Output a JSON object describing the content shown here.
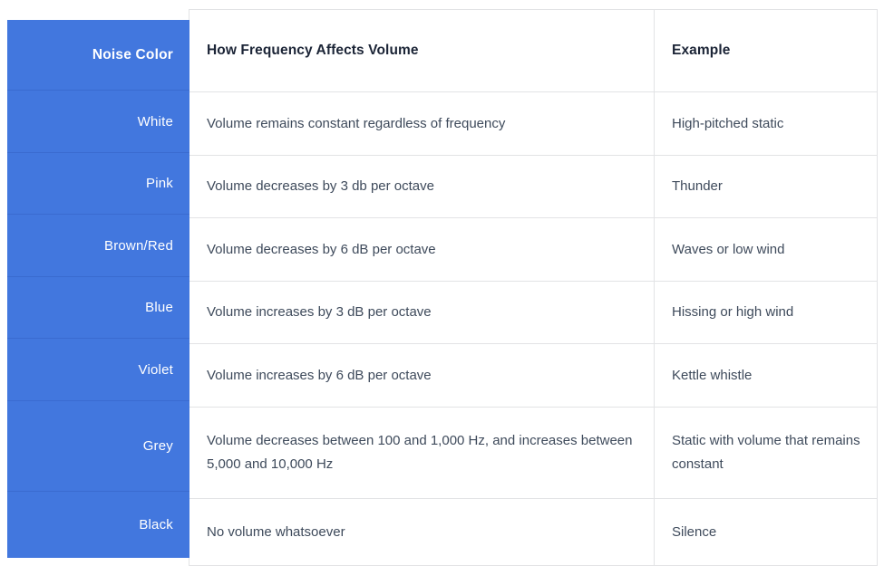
{
  "table": {
    "headers": {
      "color": "Noise Color",
      "description": "How Frequency Affects Volume",
      "example": "Example"
    },
    "accent_color": "#4277de",
    "header_text_color": "#1b2436",
    "body_text_color": "#3e4a5b",
    "border_color": "#e2e3e5",
    "rows": [
      {
        "color": "White",
        "description": "Volume remains constant regardless of frequency",
        "example": "High-pitched static"
      },
      {
        "color": "Pink",
        "description": "Volume decreases by 3 db per octave",
        "example": "Thunder"
      },
      {
        "color": "Brown/Red",
        "description": "Volume decreases by 6 dB per octave",
        "example": "Waves or low wind"
      },
      {
        "color": "Blue",
        "description": "Volume increases by 3 dB per octave",
        "example": "Hissing or high wind"
      },
      {
        "color": "Violet",
        "description": "Volume increases by 6 dB per octave",
        "example": "Kettle whistle"
      },
      {
        "color": "Grey",
        "description": "Volume decreases between 100 and 1,000 Hz, and increases between 5,000 and 10,000 Hz",
        "example": "Static with volume that remains constant"
      },
      {
        "color": "Black",
        "description": "No volume whatsoever",
        "example": "Silence"
      }
    ]
  }
}
